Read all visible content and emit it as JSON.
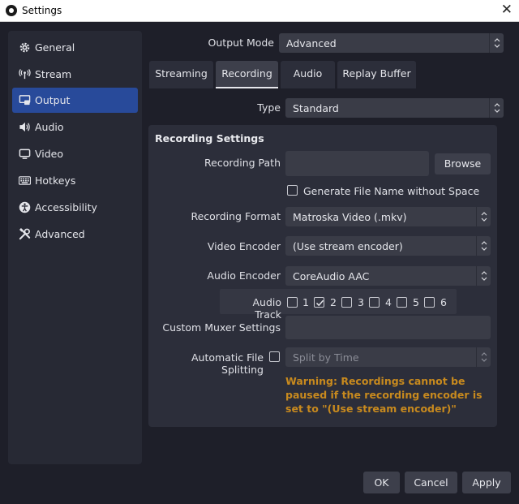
{
  "window": {
    "title": "Settings"
  },
  "sidebar": {
    "items": [
      {
        "label": "General",
        "icon": "gear-icon"
      },
      {
        "label": "Stream",
        "icon": "antenna-icon"
      },
      {
        "label": "Output",
        "icon": "output-icon",
        "active": true
      },
      {
        "label": "Audio",
        "icon": "speaker-icon"
      },
      {
        "label": "Video",
        "icon": "monitor-icon"
      },
      {
        "label": "Hotkeys",
        "icon": "keyboard-icon"
      },
      {
        "label": "Accessibility",
        "icon": "accessibility-icon"
      },
      {
        "label": "Advanced",
        "icon": "tools-icon"
      }
    ]
  },
  "output": {
    "mode_label": "Output Mode",
    "mode_value": "Advanced",
    "tabs": [
      {
        "label": "Streaming"
      },
      {
        "label": "Recording",
        "active": true
      },
      {
        "label": "Audio"
      },
      {
        "label": "Replay Buffer"
      }
    ],
    "type_label": "Type",
    "type_value": "Standard"
  },
  "recording": {
    "group_title": "Recording Settings",
    "path_label": "Recording Path",
    "path_value": "",
    "browse_label": "Browse",
    "gen_filename_label": "Generate File Name without Space",
    "gen_filename_checked": false,
    "format_label": "Recording Format",
    "format_value": "Matroska Video (.mkv)",
    "video_encoder_label": "Video Encoder",
    "video_encoder_value": "(Use stream encoder)",
    "audio_encoder_label": "Audio Encoder",
    "audio_encoder_value": "CoreAudio AAC",
    "audio_track_label": "Audio Track",
    "audio_tracks": [
      {
        "label": "1",
        "checked": false
      },
      {
        "label": "2",
        "checked": true
      },
      {
        "label": "3",
        "checked": false
      },
      {
        "label": "4",
        "checked": false
      },
      {
        "label": "5",
        "checked": false
      },
      {
        "label": "6",
        "checked": false
      }
    ],
    "muxer_label": "Custom Muxer Settings",
    "muxer_value": "",
    "split_label": "Automatic File Splitting",
    "split_checked": false,
    "split_value": "Split by Time",
    "warning": "Warning: Recordings cannot be paused if the recording encoder is set to \"(Use stream encoder)\""
  },
  "footer": {
    "ok_label": "OK",
    "cancel_label": "Cancel",
    "apply_label": "Apply"
  },
  "colors": {
    "accent": "#284a9a",
    "warning": "#c88a1e",
    "background": "#1e1f29"
  }
}
